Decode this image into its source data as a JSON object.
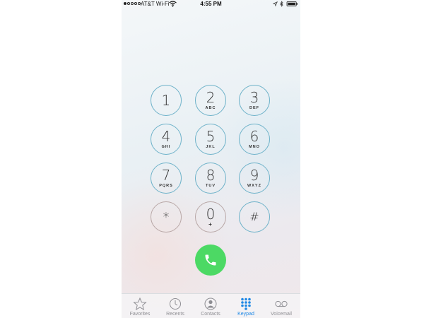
{
  "status_bar": {
    "signal_bars_filled": 1,
    "signal_bars_total": 5,
    "carrier": "AT&T Wi-Fi",
    "time": "4:55 PM",
    "icons": [
      "wifi-icon",
      "location-icon",
      "bluetooth-icon",
      "battery-icon"
    ]
  },
  "keypad": {
    "keys": [
      {
        "digit": "1",
        "letters": ""
      },
      {
        "digit": "2",
        "letters": "ABC"
      },
      {
        "digit": "3",
        "letters": "DEF"
      },
      {
        "digit": "4",
        "letters": "GHI"
      },
      {
        "digit": "5",
        "letters": "JKL"
      },
      {
        "digit": "6",
        "letters": "MNO"
      },
      {
        "digit": "7",
        "letters": "PQRS"
      },
      {
        "digit": "8",
        "letters": "TUV"
      },
      {
        "digit": "9",
        "letters": "WXYZ"
      },
      {
        "digit": "*",
        "letters": ""
      },
      {
        "digit": "0",
        "letters": "+"
      },
      {
        "digit": "#",
        "letters": ""
      }
    ],
    "call_icon": "phone-icon"
  },
  "tab_bar": {
    "tabs": [
      {
        "label": "Favorites",
        "icon": "star-icon",
        "active": false
      },
      {
        "label": "Recents",
        "icon": "clock-icon",
        "active": false
      },
      {
        "label": "Contacts",
        "icon": "person-icon",
        "active": false
      },
      {
        "label": "Keypad",
        "icon": "keypad-grid-icon",
        "active": true
      },
      {
        "label": "Voicemail",
        "icon": "voicemail-icon",
        "active": false
      }
    ]
  },
  "colors": {
    "call_green": "#4cd964",
    "active_tab_blue": "#1e88e5",
    "key_border_blue": "#6eb2c9",
    "key_border_warm": "#b8a7a6"
  }
}
